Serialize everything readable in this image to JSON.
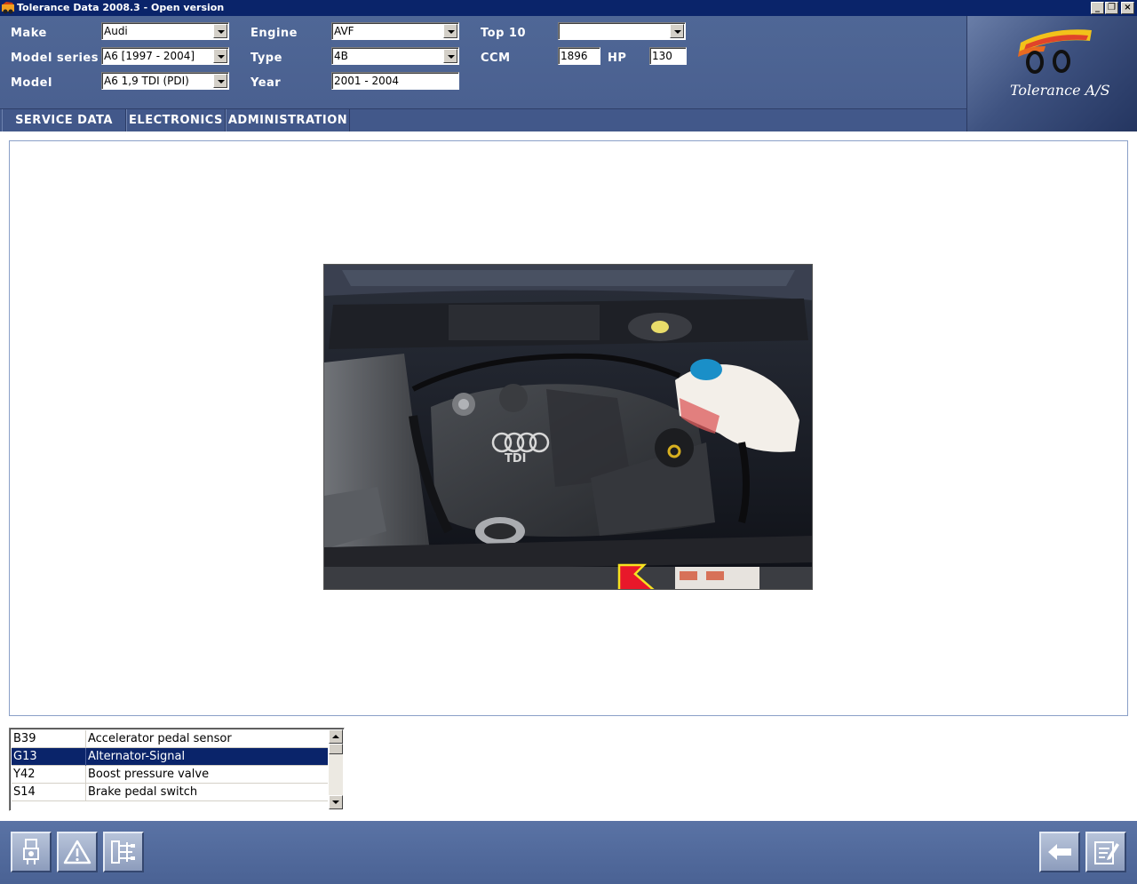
{
  "window": {
    "title": "Tolerance Data 2008.3 - Open version"
  },
  "header": {
    "make_label": "Make",
    "make_value": "Audi",
    "model_series_label": "Model series",
    "model_series_value": "A6 [1997 - 2004]",
    "model_label": "Model",
    "model_value": "A6 1,9 TDI (PDI)",
    "engine_label": "Engine",
    "engine_value": "AVF",
    "type_label": "Type",
    "type_value": "4B",
    "year_label": "Year",
    "year_value": "2001 - 2004",
    "top10_label": "Top 10",
    "top10_value": "",
    "ccm_label": "CCM",
    "ccm_value": "1896",
    "hp_label": "HP",
    "hp_value": "130"
  },
  "logo": {
    "text": "Tolerance A/S"
  },
  "menu": {
    "items": [
      {
        "label": "SERVICE DATA"
      },
      {
        "label": "ELECTRONICS"
      },
      {
        "label": "ADMINISTRATION"
      }
    ]
  },
  "component_list": {
    "rows": [
      {
        "code": "B39",
        "description": "Accelerator pedal sensor"
      },
      {
        "code": "G13",
        "description": "Alternator-Signal"
      },
      {
        "code": "Y42",
        "description": "Boost pressure valve"
      },
      {
        "code": "S14",
        "description": "Brake pedal switch"
      }
    ],
    "selected_index": 1
  },
  "photo": {
    "badge_text": "TDI"
  },
  "colors": {
    "header_bg": "#4f6796",
    "menu_bg": "#42588a",
    "selection": "#0a246a",
    "toolbar_bg": "#5a73a5",
    "pointer_arrow": "#e8182a"
  },
  "toolbar": {
    "left_buttons": [
      "sensor-icon",
      "warning-icon",
      "wiring-diagram-icon"
    ],
    "right_buttons": [
      "back-arrow-icon",
      "notes-icon"
    ]
  }
}
